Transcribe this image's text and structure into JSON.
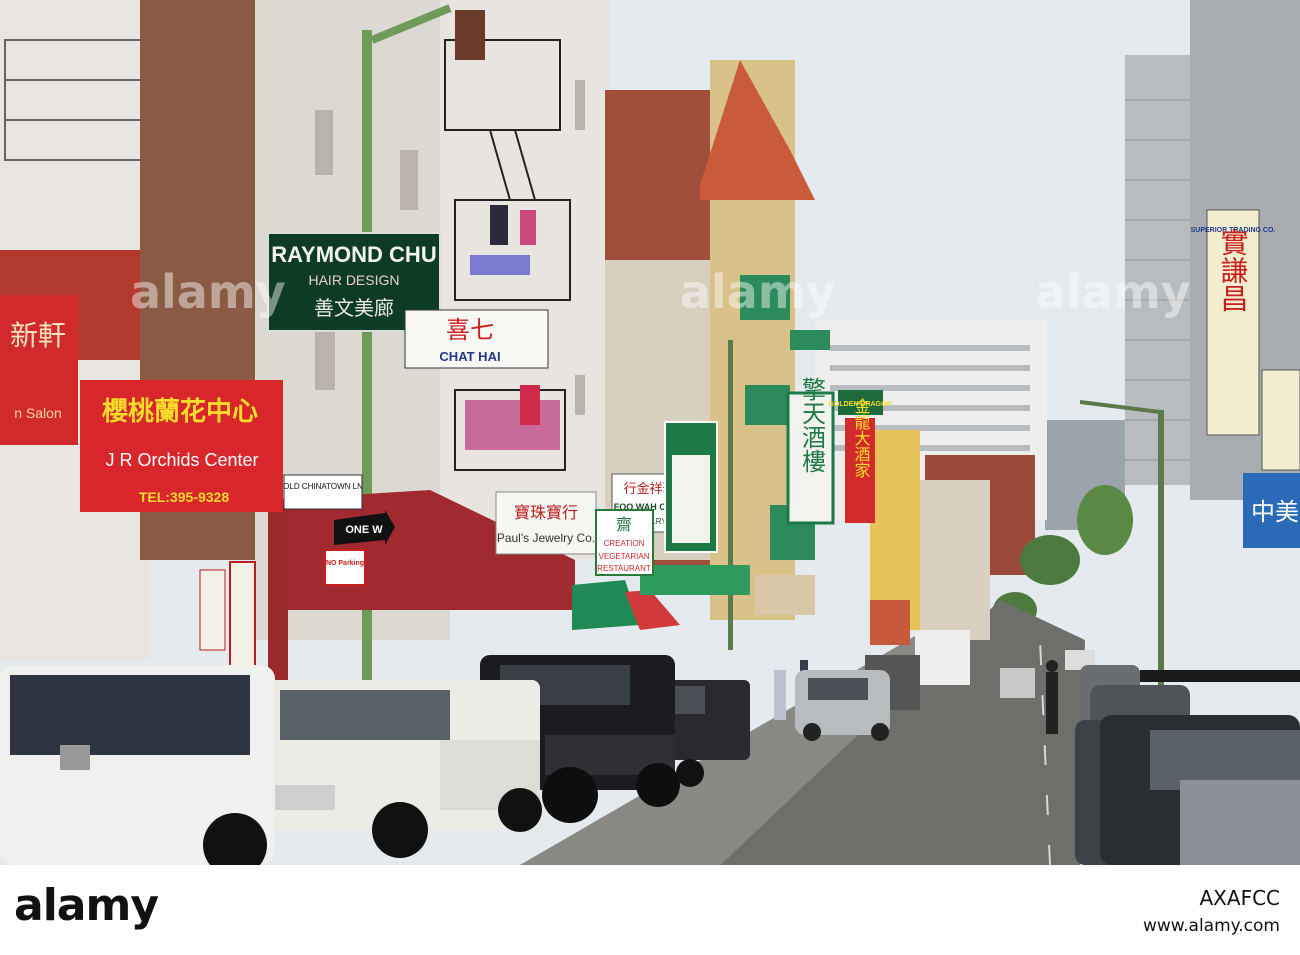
{
  "colors": {
    "sky": "#e6ecef",
    "street": "#6f6f6c",
    "sign_red": "#d62a2a",
    "sign_green": "#1e7a45",
    "awning_red": "#a3232a",
    "awning_green": "#1f8a56"
  },
  "signs": {
    "raymond_chu": "RAYMOND CHU",
    "hair_design": "HAIR DESIGN",
    "raymond_chinese": "善文美廊",
    "chat_hai": "CHAT HAI",
    "chat_hai_chinese": "喜七",
    "orchids_chinese": "櫻桃蘭花中心",
    "orchids_name": "J R Orchids Center",
    "orchids_tel": "TEL:395-9328",
    "salon_partial": "n Salon",
    "salon_chinese": "新軒",
    "one_way": "ONE W",
    "old_chinatown": "OLD CHINATOWN LN",
    "pauls_jewelry": "Paul's Jewelry Co.",
    "pauls_chinese": "寶珠寶行",
    "foo_wah_cheung": "FOO WAH CHEUNG",
    "foo_wah_sub": "JEWELRY CO.",
    "foo_wah_chinese": "行金祥華富",
    "vegetarian": "VEGETARIAN",
    "restaurant": "RESTAURANT",
    "creation": "CREATION",
    "vegetarian_chinese": "齋",
    "tall_green_chinese": "擎天酒樓",
    "golden_dragon": "GOLDEN DRAGON",
    "golden_dragon_chinese": "金龍大酒家",
    "superior_trading": "SUPERIOR TRADING CO.",
    "superior_chinese": "實謙昌",
    "blue_sign_chinese": "中美",
    "no_parking": "NO Parking"
  },
  "footer": {
    "logo": "alamy",
    "image_id": "AXAFCC",
    "url": "www.alamy.com"
  },
  "watermark": "alamy"
}
